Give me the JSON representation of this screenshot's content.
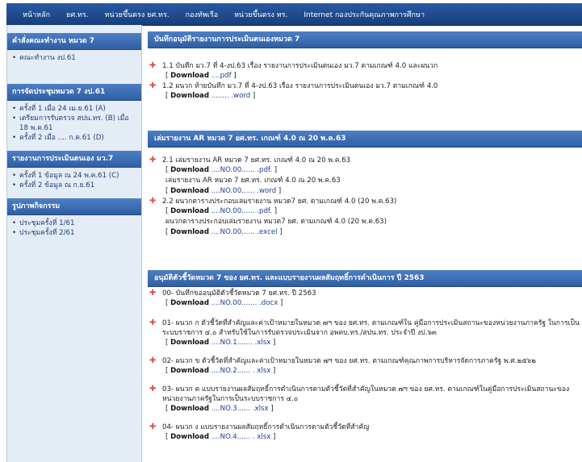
{
  "nav": {
    "items": [
      "หน้าหลัก",
      "ยศ.ทร.",
      "หน่วยขึ้นตรง ยศ.ทร.",
      "กองทัพเรือ",
      "หน่วยขึ้นตรง ทร.",
      "Internet กองประกันคุณภาพการศึกษา"
    ]
  },
  "sidebar": {
    "blocks": [
      {
        "title": "คำสั่งคณะทำงาน หมวด 7",
        "items": [
          "คณะทำงาน งป.61"
        ]
      },
      {
        "title": "การจัดประชุมหมวด 7 งป.61",
        "items": [
          "ครั้งที่ 1 เมื่อ 24 เม.ย.61 (A)",
          "เตรียมการรับตรวจ สปน.ทร. (B) เมื่อ 18 พ.ค.61",
          "ครั้งที่ 2 เมื่อ .... ก.ค.61 (D)"
        ]
      },
      {
        "title": "รายงานการประเมินตนเอง มว.7",
        "items": [
          "ครั้งที่ 1 ข้อมูล ณ 24 พ.ค.61 (C)",
          "ครั้งที่ 2 ข้อมูล ณ ก.ย.61"
        ]
      },
      {
        "title": "รูปภาพกิจกรรม",
        "items": [
          "ประชุมครั้งที่ 1/61",
          "ประชุมครั้งที่ 2/61"
        ]
      }
    ]
  },
  "main": {
    "sections": [
      {
        "title": "บันทึกอนุมัติรายงานการประเมินตนเองหมวด 7",
        "item1": "1.1  บันทึก มว.7 ที่ 4-งป.63 เรื่อง รายงานการประเมินตนเอง มว.7 ตามเกณฑ์ 4.0 และผนวก",
        "dl1": "Download",
        "dl1_link": "....pdf",
        "item2": "1.2  ผนวก ท้ายบันทึก มว.7 ที่ 4-งป.63 เรื่อง รายงานการประเมินตนเอง มว.7 ตามเกณฑ์ 4.0",
        "dl2": "Download",
        "dl2_link": "........ .word"
      },
      {
        "title": "เล่มรายงาน AR หมวด 7 ยศ.ทร. เกณฑ์ 4.0 ณ 20 พ.ค.63",
        "item1": "2.1  เล่มรายงาน AR หมวด 7 ยศ.ทร. เกณฑ์ 4.0 ณ 20 พ.ค.63",
        "dl1": "Download",
        "dl1_link": "....NO.00...... .pdf.",
        "sub1": "เล่มรายงาน AR หมวด 7 ยศ.ทร. เกณฑ์ 4.0 ณ 20 พ.ค.63",
        "dl2": "Download",
        "dl2_link": "....NO.00...... .word",
        "item2": "2.2  ผนวกตารางประกอบเล่มรายงาน หมวด7 ยศ. ตามเกณฑ์ 4.0 (20 พ.ค.63)",
        "dl3": "Download",
        "dl3_link": "....NO.00...... .pdf.",
        "sub2": "ผนวกตารางประกอบเล่มรายงาน หมวด7 ยศ. ตามเกณฑ์ 4.0 (20 พ.ค.63)",
        "dl4": "Download",
        "dl4_link": "....NO.00...... .excel"
      },
      {
        "title": "อนุมัติตัวชี้วัดหมวด 7 ของ ยศ.ทร. และแบบรายงานผลสัมฤทธิ์การดำเนินการ ปี 2563",
        "item0": "00- บันทึกขออนุมัติตัวชี้วัดหมวด 7 ยศ.ทร. ปี 2563",
        "dl0": "Download",
        "dl0_link": "....NO.00....... .docx",
        "item1": "01- ผนวก ก ตัวชี้วัดที่สำคัญและค่าเป้าหมายในหมวด ๗ฯ ของ ยศ.ทร. ตามเกณฑ์ใน คู่มือการประเมินสถานะของหน่วยงานภาครัฐ ในการเป็นระบบราชการ ๔.๐ สำหรับใช้ในการรับตรวจประเมินจาก อพคบ.ทร./สปน.ทร. ประจำปี งป.๖๓",
        "dl1": "Download",
        "dl1_link": "....NO.1....... .xlsx",
        "item2": "02- ผนวก ข ตัวชี้วัดที่สำคัญและค่าเป้าหมายในหมวด ๗ฯ ของ ยศ.ทร. ตามเกณฑ์คุณภาพการบริหารจัดการภาครัฐ พ.ศ.๒๕๖๒",
        "dl2": "Download",
        "dl2_link": "....NO.2...... . xlsx",
        "item3": "03- ผนวก ค แบบรายงานผลสัมฤทธิ์การดำเนินการตามตัวชี้วัดที่สำคัญในหมวด ๗ฯ ของ ยศ.ทร. ตามเกณฑ์ในคู่มือการประเมินสถานะของหน่วยงานภาครัฐในการเป็นระบบราชการ ๔.๐",
        "dl3": "Download",
        "dl3_link": "....NO.3...... .xlsx",
        "item4": "04- ผนวก ง แบบรายงานผลสัมฤทธิ์การดำเนินการตามตัวชี้วัดที่สำคัญ",
        "dl4": "Download",
        "dl4_link": "....NO.4...... . xlsx"
      }
    ]
  },
  "colors": {
    "nav_bg": "#1e4a8c",
    "section_header": "#3a6bb3",
    "sidebar_bg": "#e4ecf6",
    "bullet": "#d9534f"
  }
}
